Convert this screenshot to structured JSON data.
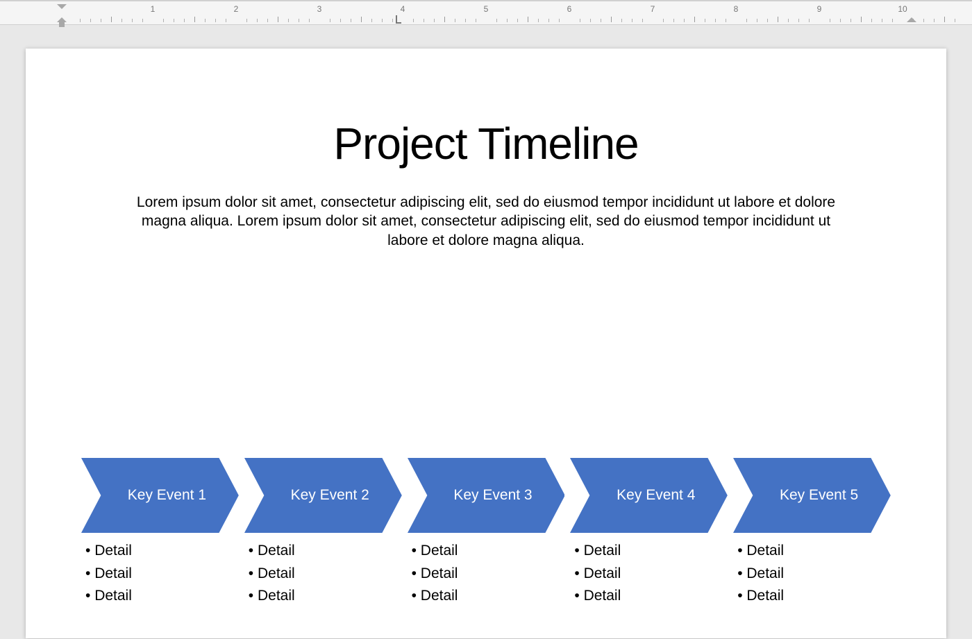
{
  "ruler": {
    "numbers": [
      "1",
      "2",
      "3",
      "4",
      "5",
      "6",
      "7",
      "8",
      "9",
      "10"
    ]
  },
  "slide": {
    "title": "Project Timeline",
    "body": "Lorem ipsum dolor sit amet, consectetur adipiscing elit, sed do eiusmod tempor incididunt ut labore et dolore magna aliqua. Lorem ipsum dolor sit amet, consectetur adipiscing elit, sed do eiusmod tempor incididunt ut labore et dolore magna aliqua."
  },
  "colors": {
    "chevron": "#4472C4"
  },
  "timeline": {
    "events": [
      {
        "label": "Key Event 1",
        "details": [
          "Detail",
          "Detail",
          "Detail"
        ]
      },
      {
        "label": "Key Event 2",
        "details": [
          "Detail",
          "Detail",
          "Detail"
        ]
      },
      {
        "label": "Key Event 3",
        "details": [
          "Detail",
          "Detail",
          "Detail"
        ]
      },
      {
        "label": "Key Event 4",
        "details": [
          "Detail",
          "Detail",
          "Detail"
        ]
      },
      {
        "label": "Key Event 5",
        "details": [
          "Detail",
          "Detail",
          "Detail"
        ]
      }
    ]
  }
}
